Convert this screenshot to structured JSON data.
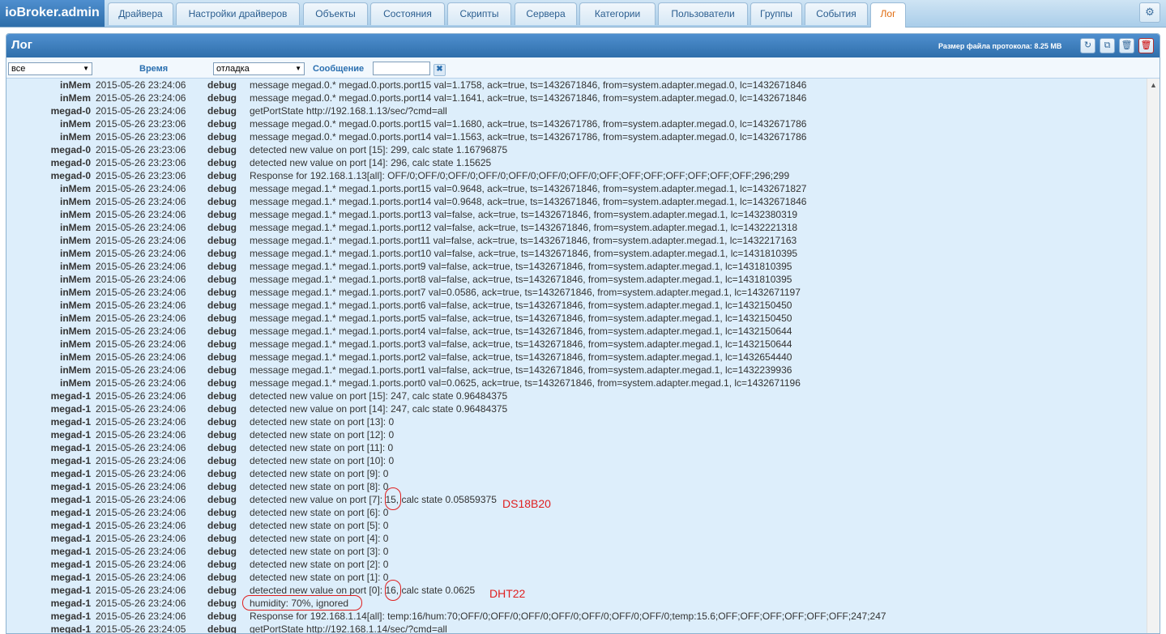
{
  "app": {
    "title": "ioBroker.admin"
  },
  "tabs": [
    {
      "label": "Драйвера"
    },
    {
      "label": "Настройки драйверов"
    },
    {
      "label": "Объекты"
    },
    {
      "label": "Состояния"
    },
    {
      "label": "Скрипты"
    },
    {
      "label": "Сервера"
    },
    {
      "label": "Категории"
    },
    {
      "label": "Пользователи"
    },
    {
      "label": "Группы"
    },
    {
      "label": "События"
    },
    {
      "label": "Лог",
      "active": true
    }
  ],
  "settings": {
    "icon": "gear-icon",
    "glyph": "⚙"
  },
  "panel": {
    "title": "Лог",
    "file_size_label": "Размер файла протокола: 8.25 MB",
    "buttons": [
      {
        "name": "refresh",
        "icon": "refresh-icon",
        "glyph": "↻"
      },
      {
        "name": "copy",
        "icon": "copy-icon",
        "glyph": "⧉"
      },
      {
        "name": "clear-list",
        "icon": "trash-icon",
        "glyph": "🗑"
      },
      {
        "name": "delete-log",
        "icon": "trash-red-icon",
        "glyph": "🗑"
      }
    ]
  },
  "filters": {
    "source_value": "все",
    "time_header": "Время",
    "level_value": "отладка",
    "message_header": "Сообщение",
    "message_filter_value": "",
    "clear_glyph": "✖"
  },
  "colors": {
    "accent": "#2f6fab",
    "active_tab_text": "#e06a0d",
    "annotation": "#e02020",
    "panel_bg": "#ddeefb"
  },
  "log": [
    {
      "src": "inMem",
      "time": "2015-05-26 23:24:06",
      "level": "debug",
      "msg": "message megad.0.* megad.0.ports.port15 val=1.1758, ack=true, ts=1432671846, from=system.adapter.megad.0, lc=1432671846"
    },
    {
      "src": "inMem",
      "time": "2015-05-26 23:24:06",
      "level": "debug",
      "msg": "message megad.0.* megad.0.ports.port14 val=1.1641, ack=true, ts=1432671846, from=system.adapter.megad.0, lc=1432671846"
    },
    {
      "src": "megad-0",
      "time": "2015-05-26 23:24:06",
      "level": "debug",
      "msg": "getPortState http://192.168.1.13/sec/?cmd=all"
    },
    {
      "src": "inMem",
      "time": "2015-05-26 23:23:06",
      "level": "debug",
      "msg": "message megad.0.* megad.0.ports.port15 val=1.1680, ack=true, ts=1432671786, from=system.adapter.megad.0, lc=1432671786"
    },
    {
      "src": "inMem",
      "time": "2015-05-26 23:23:06",
      "level": "debug",
      "msg": "message megad.0.* megad.0.ports.port14 val=1.1563, ack=true, ts=1432671786, from=system.adapter.megad.0, lc=1432671786"
    },
    {
      "src": "megad-0",
      "time": "2015-05-26 23:23:06",
      "level": "debug",
      "msg": "detected new value on port [15]: 299, calc state 1.16796875"
    },
    {
      "src": "megad-0",
      "time": "2015-05-26 23:23:06",
      "level": "debug",
      "msg": "detected new value on port [14]: 296, calc state 1.15625"
    },
    {
      "src": "megad-0",
      "time": "2015-05-26 23:23:06",
      "level": "debug",
      "msg": "Response for 192.168.1.13[all]: OFF/0;OFF/0;OFF/0;OFF/0;OFF/0;OFF/0;OFF/0;OFF;OFF;OFF;OFF;OFF;OFF;OFF;296;299"
    },
    {
      "src": "inMem",
      "time": "2015-05-26 23:24:06",
      "level": "debug",
      "msg": "message megad.1.* megad.1.ports.port15 val=0.9648, ack=true, ts=1432671846, from=system.adapter.megad.1, lc=1432671827"
    },
    {
      "src": "inMem",
      "time": "2015-05-26 23:24:06",
      "level": "debug",
      "msg": "message megad.1.* megad.1.ports.port14 val=0.9648, ack=true, ts=1432671846, from=system.adapter.megad.1, lc=1432671846"
    },
    {
      "src": "inMem",
      "time": "2015-05-26 23:24:06",
      "level": "debug",
      "msg": "message megad.1.* megad.1.ports.port13 val=false, ack=true, ts=1432671846, from=system.adapter.megad.1, lc=1432380319"
    },
    {
      "src": "inMem",
      "time": "2015-05-26 23:24:06",
      "level": "debug",
      "msg": "message megad.1.* megad.1.ports.port12 val=false, ack=true, ts=1432671846, from=system.adapter.megad.1, lc=1432221318"
    },
    {
      "src": "inMem",
      "time": "2015-05-26 23:24:06",
      "level": "debug",
      "msg": "message megad.1.* megad.1.ports.port11 val=false, ack=true, ts=1432671846, from=system.adapter.megad.1, lc=1432217163"
    },
    {
      "src": "inMem",
      "time": "2015-05-26 23:24:06",
      "level": "debug",
      "msg": "message megad.1.* megad.1.ports.port10 val=false, ack=true, ts=1432671846, from=system.adapter.megad.1, lc=1431810395"
    },
    {
      "src": "inMem",
      "time": "2015-05-26 23:24:06",
      "level": "debug",
      "msg": "message megad.1.* megad.1.ports.port9 val=false, ack=true, ts=1432671846, from=system.adapter.megad.1, lc=1431810395"
    },
    {
      "src": "inMem",
      "time": "2015-05-26 23:24:06",
      "level": "debug",
      "msg": "message megad.1.* megad.1.ports.port8 val=false, ack=true, ts=1432671846, from=system.adapter.megad.1, lc=1431810395"
    },
    {
      "src": "inMem",
      "time": "2015-05-26 23:24:06",
      "level": "debug",
      "msg": "message megad.1.* megad.1.ports.port7 val=0.0586, ack=true, ts=1432671846, from=system.adapter.megad.1, lc=1432671197"
    },
    {
      "src": "inMem",
      "time": "2015-05-26 23:24:06",
      "level": "debug",
      "msg": "message megad.1.* megad.1.ports.port6 val=false, ack=true, ts=1432671846, from=system.adapter.megad.1, lc=1432150450"
    },
    {
      "src": "inMem",
      "time": "2015-05-26 23:24:06",
      "level": "debug",
      "msg": "message megad.1.* megad.1.ports.port5 val=false, ack=true, ts=1432671846, from=system.adapter.megad.1, lc=1432150450"
    },
    {
      "src": "inMem",
      "time": "2015-05-26 23:24:06",
      "level": "debug",
      "msg": "message megad.1.* megad.1.ports.port4 val=false, ack=true, ts=1432671846, from=system.adapter.megad.1, lc=1432150644"
    },
    {
      "src": "inMem",
      "time": "2015-05-26 23:24:06",
      "level": "debug",
      "msg": "message megad.1.* megad.1.ports.port3 val=false, ack=true, ts=1432671846, from=system.adapter.megad.1, lc=1432150644"
    },
    {
      "src": "inMem",
      "time": "2015-05-26 23:24:06",
      "level": "debug",
      "msg": "message megad.1.* megad.1.ports.port2 val=false, ack=true, ts=1432671846, from=system.adapter.megad.1, lc=1432654440"
    },
    {
      "src": "inMem",
      "time": "2015-05-26 23:24:06",
      "level": "debug",
      "msg": "message megad.1.* megad.1.ports.port1 val=false, ack=true, ts=1432671846, from=system.adapter.megad.1, lc=1432239936"
    },
    {
      "src": "inMem",
      "time": "2015-05-26 23:24:06",
      "level": "debug",
      "msg": "message megad.1.* megad.1.ports.port0 val=0.0625, ack=true, ts=1432671846, from=system.adapter.megad.1, lc=1432671196"
    },
    {
      "src": "megad-1",
      "time": "2015-05-26 23:24:06",
      "level": "debug",
      "msg": "detected new value on port [15]: 247, calc state 0.96484375"
    },
    {
      "src": "megad-1",
      "time": "2015-05-26 23:24:06",
      "level": "debug",
      "msg": "detected new value on port [14]: 247, calc state 0.96484375"
    },
    {
      "src": "megad-1",
      "time": "2015-05-26 23:24:06",
      "level": "debug",
      "msg": "detected new state on port [13]: 0"
    },
    {
      "src": "megad-1",
      "time": "2015-05-26 23:24:06",
      "level": "debug",
      "msg": "detected new state on port [12]: 0"
    },
    {
      "src": "megad-1",
      "time": "2015-05-26 23:24:06",
      "level": "debug",
      "msg": "detected new state on port [11]: 0"
    },
    {
      "src": "megad-1",
      "time": "2015-05-26 23:24:06",
      "level": "debug",
      "msg": "detected new state on port [10]: 0"
    },
    {
      "src": "megad-1",
      "time": "2015-05-26 23:24:06",
      "level": "debug",
      "msg": "detected new state on port [9]: 0"
    },
    {
      "src": "megad-1",
      "time": "2015-05-26 23:24:06",
      "level": "debug",
      "msg": "detected new state on port [8]: 0"
    },
    {
      "src": "megad-1",
      "time": "2015-05-26 23:24:06",
      "level": "debug",
      "msg": "detected new value on port [7]: 15, calc state 0.05859375"
    },
    {
      "src": "megad-1",
      "time": "2015-05-26 23:24:06",
      "level": "debug",
      "msg": "detected new state on port [6]: 0"
    },
    {
      "src": "megad-1",
      "time": "2015-05-26 23:24:06",
      "level": "debug",
      "msg": "detected new state on port [5]: 0"
    },
    {
      "src": "megad-1",
      "time": "2015-05-26 23:24:06",
      "level": "debug",
      "msg": "detected new state on port [4]: 0"
    },
    {
      "src": "megad-1",
      "time": "2015-05-26 23:24:06",
      "level": "debug",
      "msg": "detected new state on port [3]: 0"
    },
    {
      "src": "megad-1",
      "time": "2015-05-26 23:24:06",
      "level": "debug",
      "msg": "detected new state on port [2]: 0"
    },
    {
      "src": "megad-1",
      "time": "2015-05-26 23:24:06",
      "level": "debug",
      "msg": "detected new state on port [1]: 0"
    },
    {
      "src": "megad-1",
      "time": "2015-05-26 23:24:06",
      "level": "debug",
      "msg": "detected new value on port [0]: 16, calc state 0.0625"
    },
    {
      "src": "megad-1",
      "time": "2015-05-26 23:24:06",
      "level": "debug",
      "msg": "humidity: 70%, ignored"
    },
    {
      "src": "megad-1",
      "time": "2015-05-26 23:24:06",
      "level": "debug",
      "msg": "Response for 192.168.1.14[all]: temp:16/hum:70;OFF/0;OFF/0;OFF/0;OFF/0;OFF/0;OFF/0;OFF/0;temp:15.6;OFF;OFF;OFF;OFF;OFF;OFF;247;247"
    },
    {
      "src": "megad-1",
      "time": "2015-05-26 23:24:05",
      "level": "debug",
      "msg": "getPortState http://192.168.1.14/sec/?cmd=all"
    }
  ],
  "annotations": {
    "first": "DS18B20",
    "second": "DHT22"
  }
}
